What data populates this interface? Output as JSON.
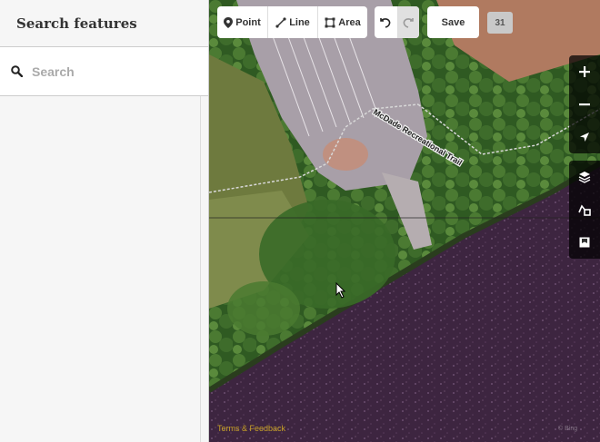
{
  "sidebar": {
    "title": "Search features",
    "search_placeholder": "Search"
  },
  "toolbar": {
    "modes": [
      {
        "label": "Point",
        "icon": "point-icon"
      },
      {
        "label": "Line",
        "icon": "line-icon"
      },
      {
        "label": "Area",
        "icon": "area-icon"
      }
    ],
    "undo_icon": "undo-icon",
    "redo_icon": "redo-icon",
    "save_label": "Save",
    "edit_count": "31"
  },
  "map": {
    "trail_label": "McDade Recreational Trail",
    "footer_link": "Terms & Feedback",
    "controls": [
      "zoom-in-icon",
      "zoom-out-icon",
      "geolocate-icon",
      "layers-icon",
      "map-data-icon",
      "issues-icon"
    ],
    "colors": {
      "vegetation": "#3f6a2a",
      "river": "#3b2438",
      "parking": "#a89fa8",
      "trail": "#d8d8d8"
    }
  }
}
